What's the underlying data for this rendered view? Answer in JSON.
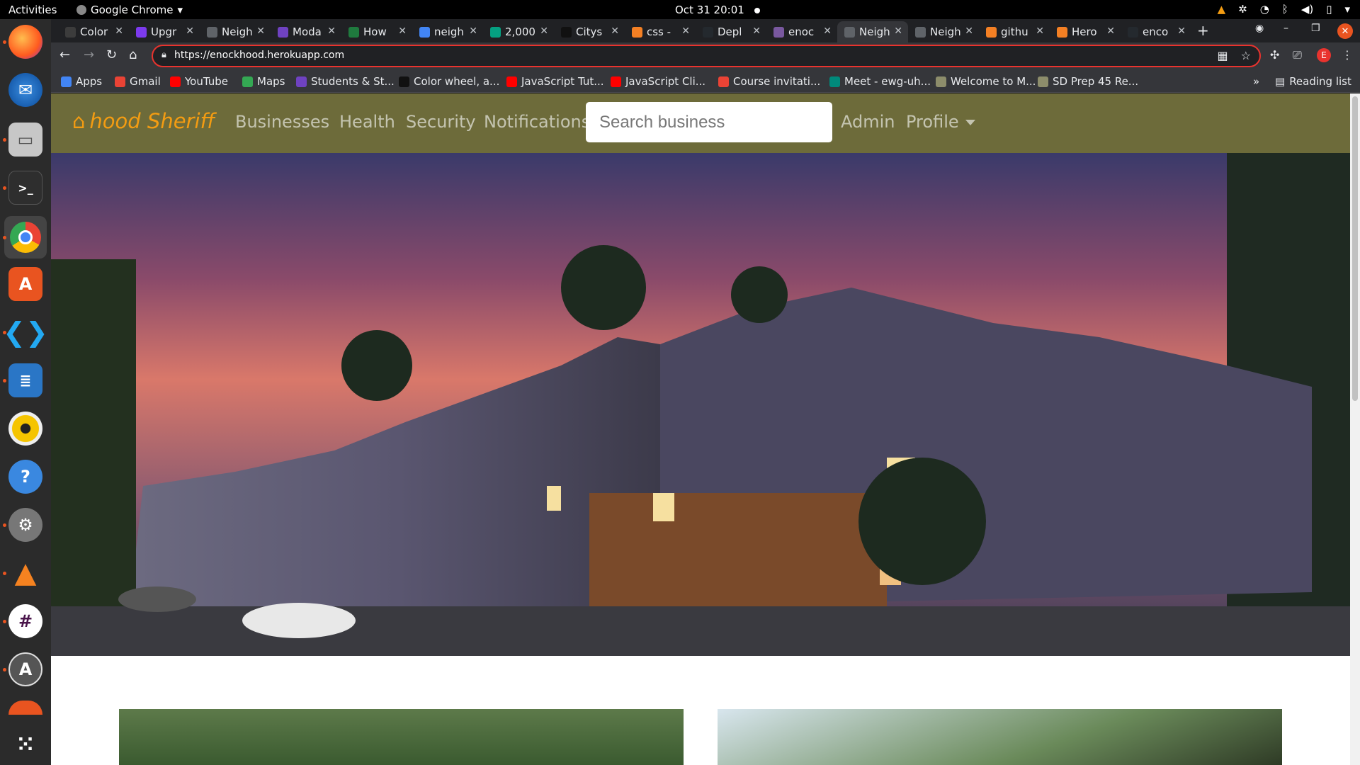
{
  "system": {
    "activities": "Activities",
    "app_name": "Google Chrome",
    "clock": "Oct 31  20:01"
  },
  "browser": {
    "tabs": [
      {
        "title": "Color",
        "color": "#3c3c3c"
      },
      {
        "title": "Upgr",
        "color": "#7c3aed"
      },
      {
        "title": "Neigh",
        "color": "#5f6368"
      },
      {
        "title": "Moda",
        "color": "#6f42c1"
      },
      {
        "title": "How",
        "color": "#1f7a3e"
      },
      {
        "title": "neigh",
        "color": "#4285f4"
      },
      {
        "title": "2,000",
        "color": "#05a081"
      },
      {
        "title": "Citys",
        "color": "#111111"
      },
      {
        "title": "css -",
        "color": "#f48024"
      },
      {
        "title": "Depl",
        "color": "#24292e"
      },
      {
        "title": "enoc",
        "color": "#79589f"
      },
      {
        "title": "Neigh",
        "color": "#5f6368"
      },
      {
        "title": "Neigh",
        "color": "#5f6368"
      },
      {
        "title": "githu",
        "color": "#f48024"
      },
      {
        "title": "Hero",
        "color": "#f48024"
      },
      {
        "title": "enco",
        "color": "#24292e"
      }
    ],
    "active_tab_index": 11,
    "url": "https://enockhood.herokuapp.com",
    "profile_initial": "E",
    "bookmarks": [
      {
        "label": "Apps",
        "color": "#4285f4"
      },
      {
        "label": "Gmail",
        "color": "#ea4335"
      },
      {
        "label": "YouTube",
        "color": "#ff0000"
      },
      {
        "label": "Maps",
        "color": "#34a853"
      },
      {
        "label": "Students & St...",
        "color": "#6f42c1"
      },
      {
        "label": "Color wheel, a...",
        "color": "#111111"
      },
      {
        "label": "JavaScript Tut...",
        "color": "#ff0000"
      },
      {
        "label": "JavaScript Cli...",
        "color": "#ff0000"
      },
      {
        "label": "Course invitati...",
        "color": "#ea4335"
      },
      {
        "label": "Meet - ewg-uh...",
        "color": "#00897b"
      },
      {
        "label": "Welcome to M...",
        "color": "#8d8d6b"
      },
      {
        "label": "SD Prep 45 Re...",
        "color": "#8d8d6b"
      }
    ],
    "reading_list": "Reading list"
  },
  "site": {
    "brand": "hood Sheriff",
    "nav": [
      "Businesses",
      "Health",
      "Security",
      "Notifications"
    ],
    "search_placeholder": "Search business",
    "admin": "Admin",
    "profile": "Profile",
    "nav_color": "#6d6b3a",
    "brand_color": "#f39c12"
  }
}
